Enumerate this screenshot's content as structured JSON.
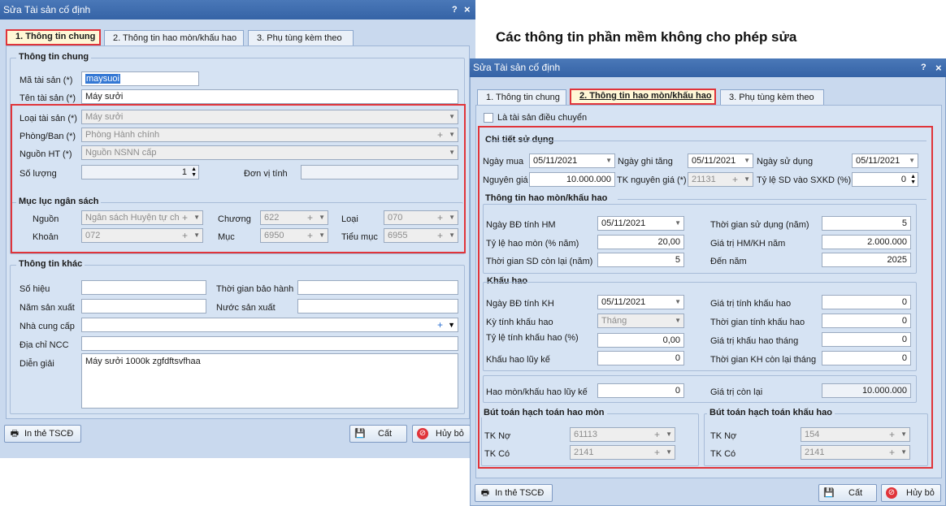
{
  "heading": "Các thông tin phần mềm không cho phép sửa",
  "left": {
    "title": "Sửa Tài sản cố định",
    "help": "?",
    "close": "×",
    "tabs": [
      "1. Thông tin chung",
      "2. Thông tin hao mòn/khấu hao",
      "3. Phụ tùng kèm theo"
    ],
    "general_title": "Thông tin chung",
    "asset_code_label": "Mã tài sản (*)",
    "asset_code_value": "maysuoi",
    "asset_name_label": "Tên tài sản (*)",
    "asset_name_value": "Máy sưởi",
    "asset_type_label": "Loại tài sản (*)",
    "asset_type_value": "Máy sưởi",
    "dept_label": "Phòng/Ban (*)",
    "dept_value": "Phòng Hành chính",
    "source_label": "Nguồn HT (*)",
    "source_value": "Nguồn NSNN cấp",
    "qty_label": "Số lượng",
    "qty_value": "1",
    "unit_label": "Đơn vị tính",
    "unit_value": "",
    "budget_title": "Mục lục ngân sách",
    "budget_source_label": "Nguồn",
    "budget_source_value": "Ngân sách Huyện tự ch",
    "chapter_label": "Chương",
    "chapter_value": "622",
    "type_label": "Loại",
    "type_value": "070",
    "khoan_label": "Khoản",
    "khoan_value": "072",
    "muc_label": "Mục",
    "muc_value": "6950",
    "tieumuc_label": "Tiểu mục",
    "tieumuc_value": "6955",
    "other_title": "Thông tin khác",
    "serial_label": "Số hiệu",
    "warranty_label": "Thời gian bảo hành",
    "year_label": "Năm sản xuất",
    "country_label": "Nước sản xuất",
    "supplier_label": "Nhà cung cấp",
    "address_label": "Địa chỉ NCC",
    "desc_label": "Diễn giải",
    "desc_value": "Máy sưởi 1000k zgfdftsvfhaa",
    "print_btn": "In thẻ TSCĐ",
    "save_btn": "Cất",
    "cancel_btn": "Hủy bỏ"
  },
  "right": {
    "title": "Sửa Tài sản cố định",
    "help": "?",
    "close": "×",
    "tabs": [
      "1. Thông tin chung",
      "2. Thông tin hao mòn/khấu hao",
      "3. Phụ tùng kèm theo"
    ],
    "transfer_label": "Là tài sản điều chuyển",
    "usage_title": "Chi tiết sử dụng",
    "buy_date_label": "Ngày mua",
    "buy_date_value": "05/11/2021",
    "record_date_label": "Ngày ghi tăng",
    "record_date_value": "05/11/2021",
    "use_date_label": "Ngày sử dụng",
    "use_date_value": "05/11/2021",
    "cost_label": "Nguyên giá",
    "cost_value": "10.000.000",
    "cost_acc_label": "TK nguyên giá (*)",
    "cost_acc_value": "21131",
    "sxkd_label": "Tỷ lệ SD vào SXKD (%)",
    "sxkd_value": "0",
    "hm_title": "Thông tin hao mòn/khấu hao",
    "hm_start_label": "Ngày BĐ tính HM",
    "hm_start_value": "05/11/2021",
    "use_time_label": "Thời gian sử dụng (năm)",
    "use_time_value": "5",
    "hm_rate_label": "Tỷ lệ hao mòn (% năm)",
    "hm_rate_value": "20,00",
    "hm_year_label": "Giá trị HM/KH năm",
    "hm_year_value": "2.000.000",
    "remain_label": "Thời gian SD còn lại (năm)",
    "remain_value": "5",
    "to_year_label": "Đến năm",
    "to_year_value": "2025",
    "kh_title": "Khấu hao",
    "kh_start_label": "Ngày BĐ tính KH",
    "kh_start_value": "05/11/2021",
    "kh_value_label": "Giá trị tính khấu hao",
    "kh_value_value": "0",
    "kh_period_label": "Kỳ tính khấu hao",
    "kh_period_value": "Tháng",
    "kh_time_label": "Thời gian tính khấu hao",
    "kh_time_value": "0",
    "kh_rate_label": "Tỷ lệ tính khấu hao (%)",
    "kh_rate_value": "0,00",
    "kh_month_label": "Giá trị khấu hao tháng",
    "kh_month_value": "0",
    "kh_acc_label": "Khấu hao lũy kế",
    "kh_acc_value": "0",
    "kh_remain_label": "Thời gian KH còn lại tháng",
    "kh_remain_value": "0",
    "total_acc_label": "Hao mòn/khấu hao lũy kế",
    "total_acc_value": "0",
    "residual_label": "Giá trị còn lại",
    "residual_value": "10.000.000",
    "hm_entry_title": "Bút toán hạch toán hao mòn",
    "kh_entry_title": "Bút toán hạch toán khấu hao",
    "debit_label": "TK Nợ",
    "credit_label": "TK Có",
    "hm_debit_value": "61113",
    "hm_credit_value": "2141",
    "kh_debit_value": "154",
    "kh_credit_value": "2141",
    "print_btn": "In thẻ TSCĐ",
    "save_btn": "Cất",
    "cancel_btn": "Hủy bỏ"
  }
}
